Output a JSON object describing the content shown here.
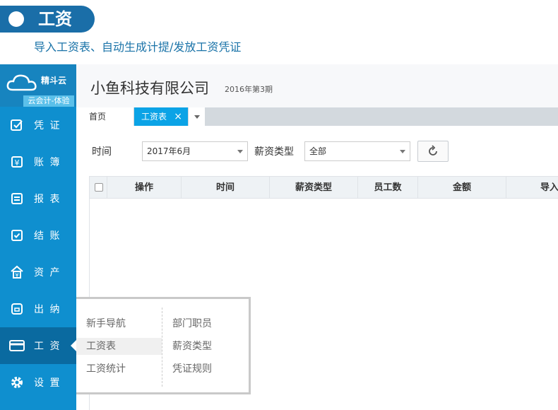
{
  "banner": {
    "title": "工资",
    "subtitle": "导入工资表、自动生成计提/发放工资凭证"
  },
  "logo": {
    "brand": "精斗云",
    "badge": "云会计-体验"
  },
  "sidebar": {
    "items": [
      {
        "label": "凭 证",
        "icon": "voucher-icon"
      },
      {
        "label": "账 簿",
        "icon": "ledger-icon"
      },
      {
        "label": "报 表",
        "icon": "report-icon"
      },
      {
        "label": "结 账",
        "icon": "checkout-icon"
      },
      {
        "label": "资 产",
        "icon": "assets-icon"
      },
      {
        "label": "出 纳",
        "icon": "cashier-icon"
      },
      {
        "label": "工 资",
        "icon": "salary-icon",
        "active": true
      },
      {
        "label": "设 置",
        "icon": "gear-icon"
      }
    ]
  },
  "header": {
    "company": "小鱼科技有限公司",
    "period": "2016年第3期"
  },
  "tabs": {
    "home": "首页",
    "active": "工资表",
    "close": "×"
  },
  "filters": {
    "time_label": "时间",
    "time_value": "2017年6月",
    "type_label": "薪资类型",
    "type_value": "全部"
  },
  "table": {
    "columns": [
      "操作",
      "时间",
      "薪资类型",
      "员工数",
      "金额",
      "导入"
    ]
  },
  "popup": {
    "left": [
      "新手导航",
      "工资表",
      "工资统计"
    ],
    "right": [
      "部门职员",
      "薪资类型",
      "凭证规则"
    ],
    "selected": "工资表"
  },
  "colors": {
    "sidebar": "#0f8fcf",
    "active_tab": "#0ba3e6",
    "banner": "#1a6ea8"
  }
}
